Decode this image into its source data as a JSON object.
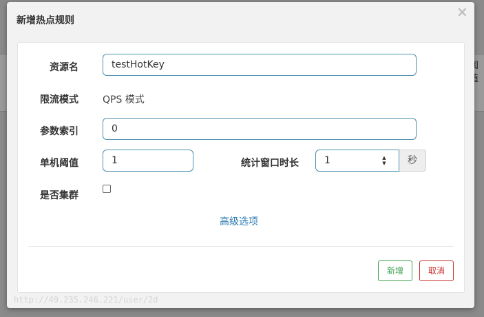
{
  "background": {
    "right_text": "阈值"
  },
  "modal": {
    "title": "新增热点规则",
    "close_label": "×"
  },
  "form": {
    "resource": {
      "label": "资源名",
      "value": "testHotKey"
    },
    "flow_mode": {
      "label": "限流模式",
      "value": "QPS 模式"
    },
    "param_index": {
      "label": "参数索引",
      "value": "0"
    },
    "threshold": {
      "label": "单机阈值",
      "value": "1"
    },
    "window": {
      "label": "统计窗口时长",
      "value": "1",
      "unit": "秒"
    },
    "cluster": {
      "label": "是否集群",
      "checked": false
    },
    "advanced_link": "高级选项"
  },
  "buttons": {
    "add": "新增",
    "cancel": "取消"
  },
  "status_url": "http://49.235.246.221/user/2d"
}
